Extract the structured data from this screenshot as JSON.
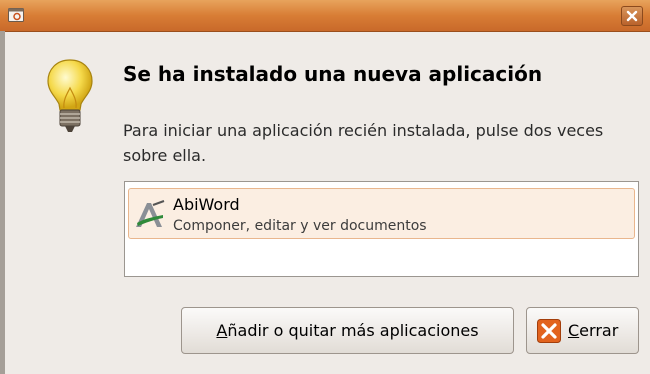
{
  "window": {
    "title": ""
  },
  "heading": "Se ha instalado una nueva aplicación",
  "description": "Para iniciar una aplicación recién instalada, pulse dos veces sobre ella.",
  "apps": [
    {
      "name": "AbiWord",
      "description": "Componer, editar y ver documentos",
      "icon": "abiword-icon"
    }
  ],
  "buttons": {
    "add_remove": {
      "mnemonic": "A",
      "rest": "ñadir o quitar más aplicaciones"
    },
    "close": {
      "mnemonic": "C",
      "rest": "errar"
    }
  },
  "colors": {
    "titlebar": "#d87d35",
    "close_icon": "#e2631e",
    "selection": "#fbeee2"
  }
}
